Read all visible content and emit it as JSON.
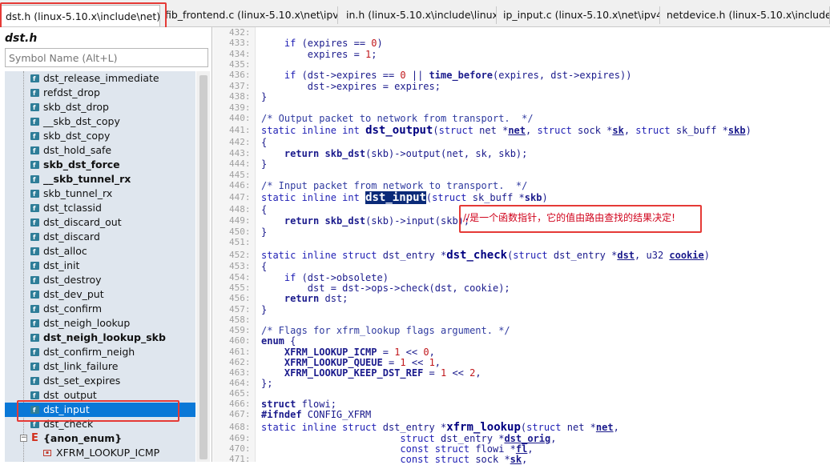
{
  "tabs": [
    {
      "label": "dst.h (linux-5.10.x\\include\\net)",
      "close": "×"
    },
    {
      "label": "fib_frontend.c (linux-5.10.x\\net\\ipv4)"
    },
    {
      "label": "in.h (linux-5.10.x\\include\\linux)"
    },
    {
      "label": "ip_input.c (linux-5.10.x\\net\\ipv4)"
    },
    {
      "label": "netdevice.h (linux-5.10.x\\include\\linux)"
    }
  ],
  "symbol_panel": {
    "file_title": "dst.h",
    "search_placeholder": "Symbol Name (Alt+L)",
    "items": [
      "dst_release_immediate",
      "refdst_drop",
      "skb_dst_drop",
      "__skb_dst_copy",
      "skb_dst_copy",
      "dst_hold_safe",
      "skb_dst_force",
      "__skb_tunnel_rx",
      "skb_tunnel_rx",
      "dst_tclassid",
      "dst_discard_out",
      "dst_discard",
      "dst_alloc",
      "dst_init",
      "dst_destroy",
      "dst_dev_put",
      "dst_confirm",
      "dst_neigh_lookup",
      "dst_neigh_lookup_skb",
      "dst_confirm_neigh",
      "dst_link_failure",
      "dst_set_expires",
      "dst_output",
      "dst_input",
      "dst_check"
    ],
    "enum_label": "{anon_enum}",
    "enum_member": "XFRM_LOOKUP_ICMP"
  },
  "editor": {
    "line_numbers": [
      "432:",
      "433:",
      "434:",
      "435:",
      "436:",
      "437:",
      "438:",
      "439:",
      "440:",
      "441:",
      "442:",
      "443:",
      "444:",
      "445:",
      "446:",
      "447:",
      "448:",
      "449:",
      "450:",
      "451:",
      "452:",
      "453:",
      "454:",
      "455:",
      "456:",
      "457:",
      "458:",
      "459:",
      "460:",
      "461:",
      "462:",
      "463:",
      "464:",
      "465:",
      "466:",
      "467:",
      "468:",
      "469:",
      "470:",
      "471:"
    ],
    "annotation": "//是一个函数指针，它的值由路由查找的结果决定!"
  },
  "colors": {
    "highlight_box": "#e53a36",
    "selection": "#0a78d7"
  }
}
